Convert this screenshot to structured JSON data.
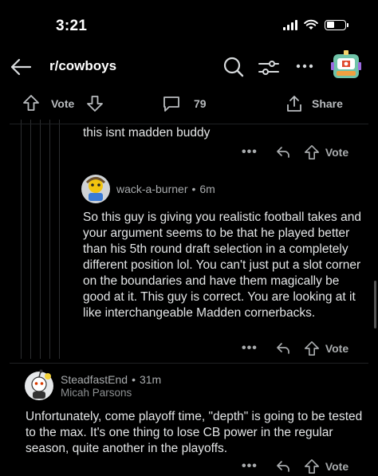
{
  "status_bar": {
    "time": "3:21"
  },
  "header": {
    "subreddit": "r/cowboys"
  },
  "post_actions": {
    "vote_label": "Vote",
    "comment_count": "79",
    "share_label": "Share"
  },
  "comments": [
    {
      "text": "this isnt madden buddy",
      "vote_label": "Vote"
    },
    {
      "username": "wack-a-burner",
      "separator": "•",
      "age": "6m",
      "text": "So this guy is giving you realistic football takes and your argument seems to be that he played better than his 5th round draft selection in a completely different position lol. You can't just put a slot corner on the boundaries and have them magically be good at it. This guy is correct. You are looking at it like interchangeable Madden cornerbacks.",
      "vote_label": "Vote"
    },
    {
      "username": "SteadfastEnd",
      "separator": "•",
      "age": "31m",
      "flair": "Micah Parsons",
      "text": "Unfortunately, come playoff time, \"depth\" is going to be tested to the max. It's one thing to lose CB power in the regular season, quite another in the playoffs.",
      "vote_label": "Vote"
    }
  ],
  "colors": {
    "background": "#000000",
    "text": "#e3e5e6",
    "muted": "#a8abad"
  }
}
